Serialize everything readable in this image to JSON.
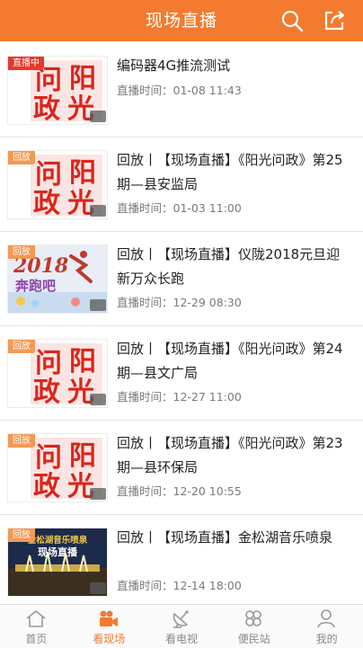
{
  "header": {
    "title": "现场直播"
  },
  "items": [
    {
      "badge": "直播中",
      "badge_type": "live",
      "title": "编码器4G推流测试",
      "time_label": "直播时间：",
      "time": "01-08 11:43",
      "thumb": "yangguang"
    },
    {
      "badge": "回放",
      "badge_type": "replay",
      "title": "回放丨【现场直播】《阳光问政》第25期—县安监局",
      "time_label": "直播时间：",
      "time": "01-03 11:00",
      "thumb": "yangguang"
    },
    {
      "badge": "回放",
      "badge_type": "replay",
      "title": "回放丨【现场直播】仪陇2018元旦迎新万众长跑",
      "time_label": "直播时间：",
      "time": "12-29 08:30",
      "thumb": "run2018"
    },
    {
      "badge": "回放",
      "badge_type": "replay",
      "title": "回放丨【现场直播】《阳光问政》第24期—县文广局",
      "time_label": "直播时间：",
      "time": "12-27 11:00",
      "thumb": "yangguang"
    },
    {
      "badge": "回放",
      "badge_type": "replay",
      "title": "回放丨【现场直播】《阳光问政》第23期—县环保局",
      "time_label": "直播时间：",
      "time": "12-20 10:55",
      "thumb": "yangguang"
    },
    {
      "badge": "回放",
      "badge_type": "replay",
      "title": "回放丨【现场直播】金松湖音乐喷泉",
      "time_label": "直播时间：",
      "time": "12-14 18:00",
      "thumb": "fountain"
    }
  ],
  "tabs": [
    {
      "label": "首页",
      "icon": "home-icon",
      "active": false
    },
    {
      "label": "看现场",
      "icon": "video-camera-icon",
      "active": true
    },
    {
      "label": "看电视",
      "icon": "satellite-dish-icon",
      "active": false
    },
    {
      "label": "便民站",
      "icon": "clover-icon",
      "active": false
    },
    {
      "label": "我的",
      "icon": "user-icon",
      "active": false
    }
  ],
  "thumb_art": {
    "yangguang_chars": [
      "问",
      "阳",
      "政",
      "光"
    ],
    "run2018_year": "2018",
    "run2018_text": "奔跑吧",
    "fountain_lines": [
      "金松湖音乐喷泉",
      "现场直播"
    ]
  },
  "colors": {
    "brand": "#f37a2e",
    "live_badge": "#e8382c",
    "replay_badge": "#f39955",
    "seal_red": "#d9261c"
  }
}
